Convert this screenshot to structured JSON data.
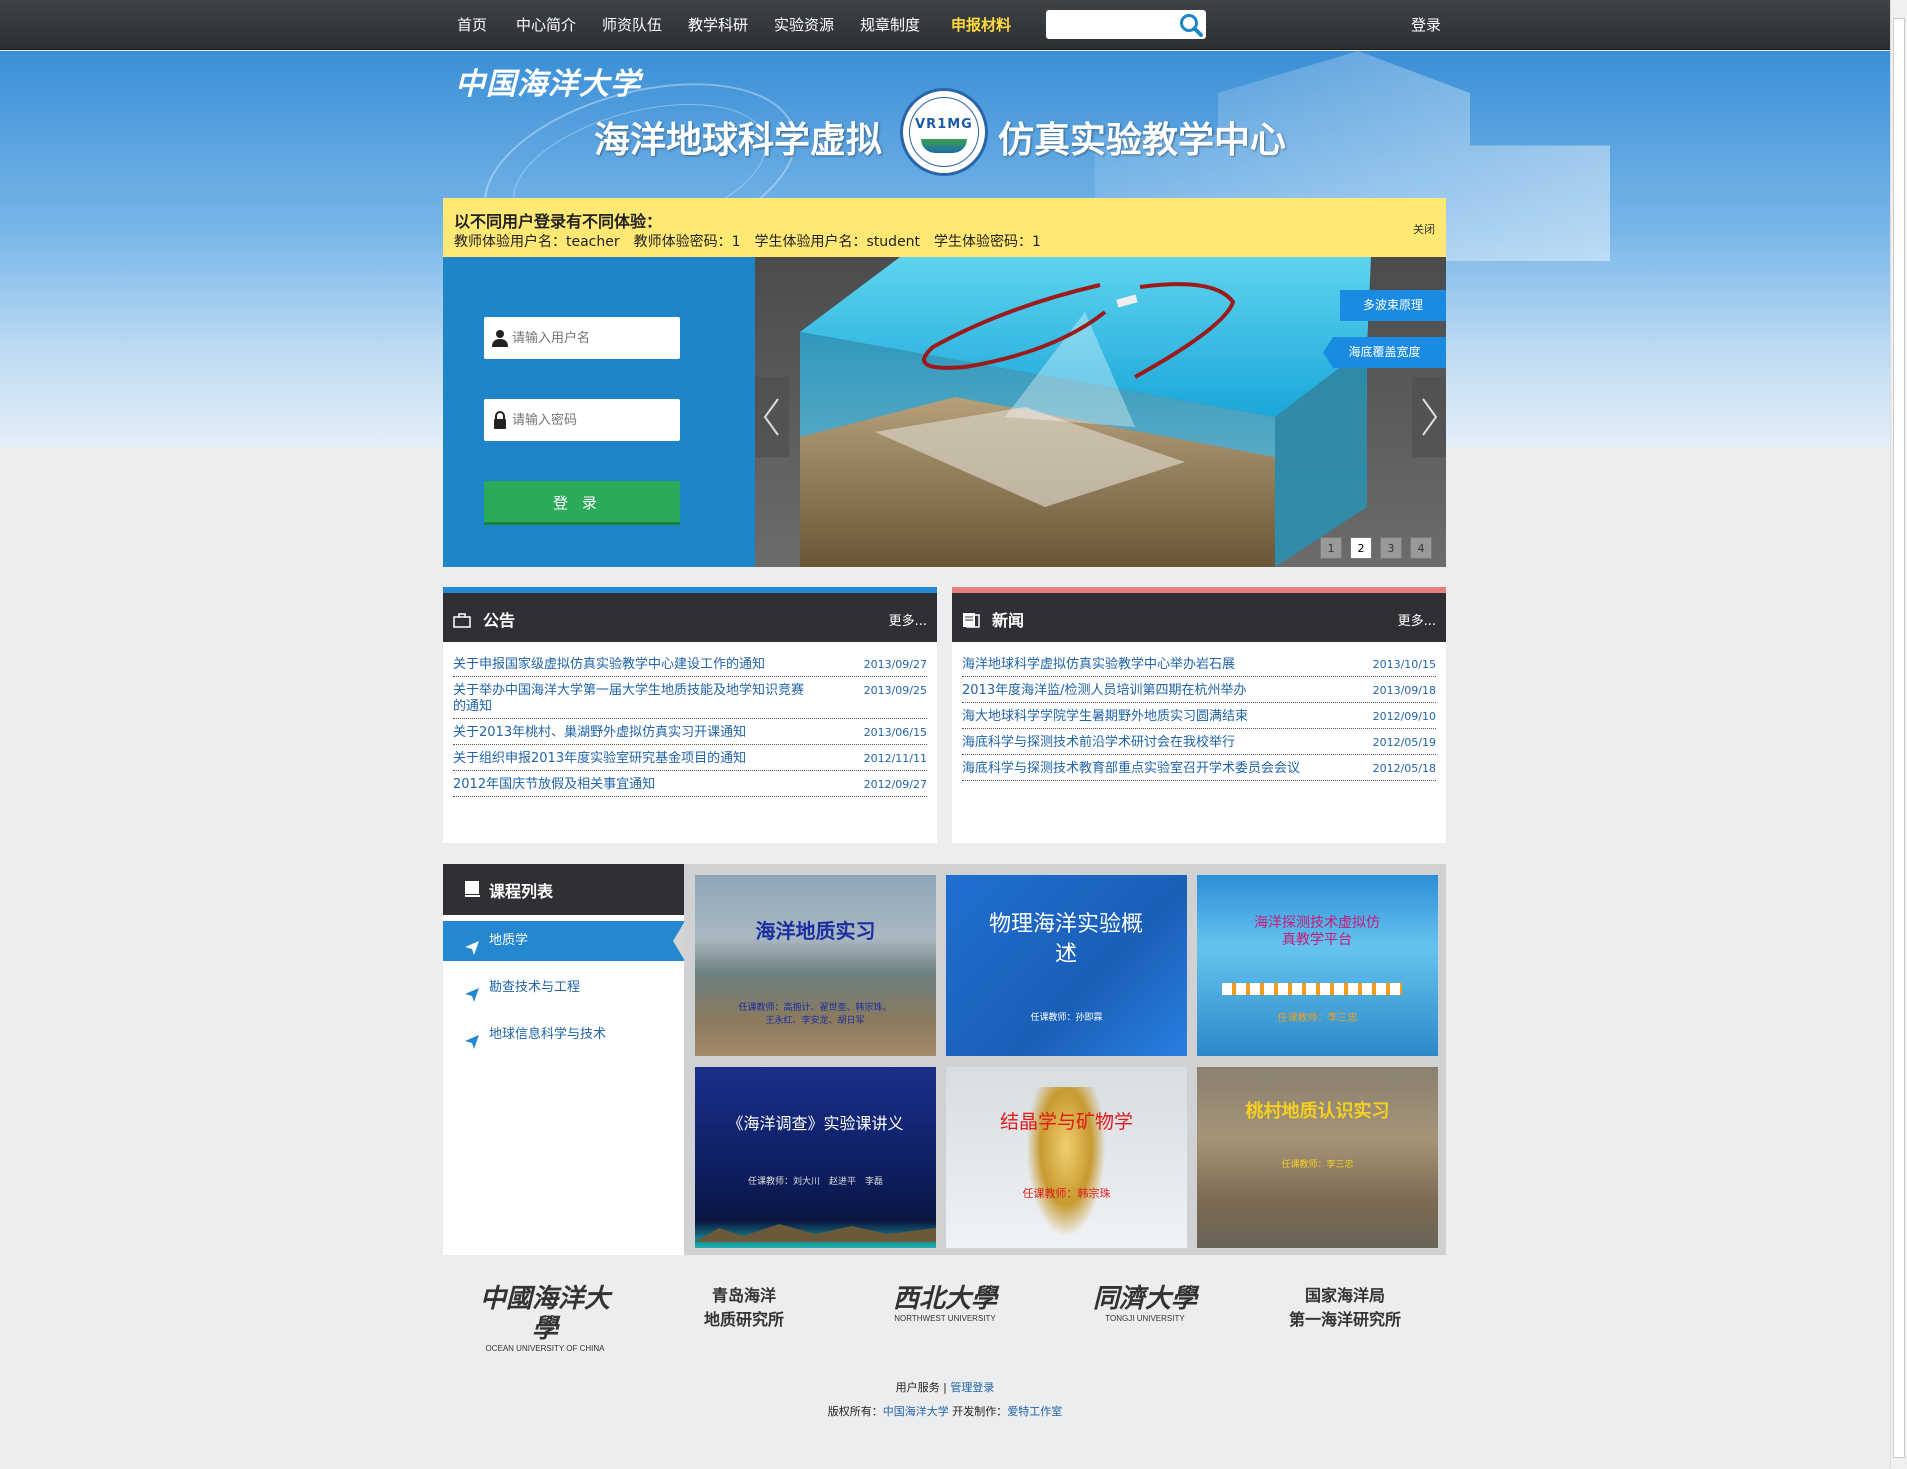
{
  "nav": {
    "items": [
      {
        "label": "首页"
      },
      {
        "label": "中心简介"
      },
      {
        "label": "师资队伍"
      },
      {
        "label": "教学科研"
      },
      {
        "label": "实验资源"
      },
      {
        "label": "规章制度"
      },
      {
        "label": "申报材料"
      }
    ],
    "active": "申报材料",
    "search_placeholder": "",
    "login": "登录"
  },
  "banner": {
    "university_logo": "中国海洋大学",
    "title_left": "海洋地球科学虚拟",
    "title_right": "仿真实验教学中心",
    "emblem_text": "VR1MG"
  },
  "notice": {
    "title": "以不同用户登录有不同体验：",
    "text": "教师体验用户名：teacher　教师体验密码：1　学生体验用户名：student　学生体验密码：1",
    "close": "关闭"
  },
  "login": {
    "username_placeholder": "请输入用户名",
    "password_placeholder": "请输入密码",
    "button": "登录"
  },
  "slider": {
    "tags": [
      "多波束原理",
      "海底覆盖宽度"
    ],
    "pages": [
      "1",
      "2",
      "3",
      "4"
    ],
    "active_page": 2
  },
  "announcements": {
    "title": "公告",
    "more": "更多...",
    "items": [
      {
        "title": "关于申报国家级虚拟仿真实验教学中心建设工作的通知",
        "date": "2013/09/27"
      },
      {
        "title": "关于举办中国海洋大学第一届大学生地质技能及地学知识竞赛的通知",
        "date": "2013/09/25"
      },
      {
        "title": "关于2013年桃村、巢湖野外虚拟仿真实习开课通知",
        "date": "2013/06/15"
      },
      {
        "title": "关于组织申报2013年度实验室研究基金项目的通知",
        "date": "2012/11/11"
      },
      {
        "title": "2012年国庆节放假及相关事宜通知",
        "date": "2012/09/27"
      }
    ]
  },
  "news": {
    "title": "新闻",
    "more": "更多...",
    "items": [
      {
        "title": "海洋地球科学虚拟仿真实验教学中心举办岩石展",
        "date": "2013/10/15"
      },
      {
        "title": "2013年度海洋监/检测人员培训第四期在杭州举办",
        "date": "2013/09/18"
      },
      {
        "title": "海大地球科学学院学生暑期野外地质实习圆满结束",
        "date": "2012/09/10"
      },
      {
        "title": "海底科学与探测技术前沿学术研讨会在我校举行",
        "date": "2012/05/19"
      },
      {
        "title": "海底科学与探测技术教育部重点实验室召开学术委员会会议",
        "date": "2012/05/18"
      }
    ]
  },
  "courses": {
    "title": "课程列表",
    "categories": [
      {
        "label": "地质学"
      },
      {
        "label": "勘查技术与工程"
      },
      {
        "label": "地球信息科学与技术"
      }
    ],
    "active": "地质学",
    "thumbnails": [
      {
        "title": "海洋地质实习",
        "subtitle": "任课教师：高抱计、翟世奎、韩宗珠、王永红、李安龙、胡日军"
      },
      {
        "title": "物理海洋实验概述",
        "subtitle": "任课教师：孙即霖"
      },
      {
        "title": "海洋探测技术虚拟仿真教学平台",
        "subtitle": "任课教师：李三忠"
      },
      {
        "title": "《海洋调查》实验课讲义",
        "subtitle": "任课教师：刘大川　赵进平　李磊"
      },
      {
        "title": "结晶学与矿物学",
        "subtitle": "任课教师：韩宗珠"
      },
      {
        "title": "桃村地质认识实习",
        "subtitle": "任课教师：李三忠"
      }
    ]
  },
  "partners": [
    {
      "name": "中國海洋大學",
      "sub": "OCEAN UNIVERSITY OF CHINA"
    },
    {
      "name": "青岛海洋\n地质研究所"
    },
    {
      "name": "西北大學",
      "sub": "NORTHWEST UNIVERSITY"
    },
    {
      "name": "同濟大學",
      "sub": "TONGJI UNIVERSITY"
    },
    {
      "name": "国家海洋局\n第一海洋研究所"
    }
  ],
  "footer": {
    "user_service": "用户服务",
    "separator": "|",
    "admin_login": "管理登录",
    "copyright_label": "版权所有：",
    "copyright_owner": "中国海洋大学",
    "developer_label": "开发制作：",
    "developer": "爱特工作室"
  },
  "colors": {
    "nav_bg": "#34363a",
    "nav_active": "#ffd940",
    "notice_bg": "#ffe873",
    "primary_blue": "#2488d1",
    "login_green": "#2baa5a",
    "link_blue": "#2164a9"
  }
}
